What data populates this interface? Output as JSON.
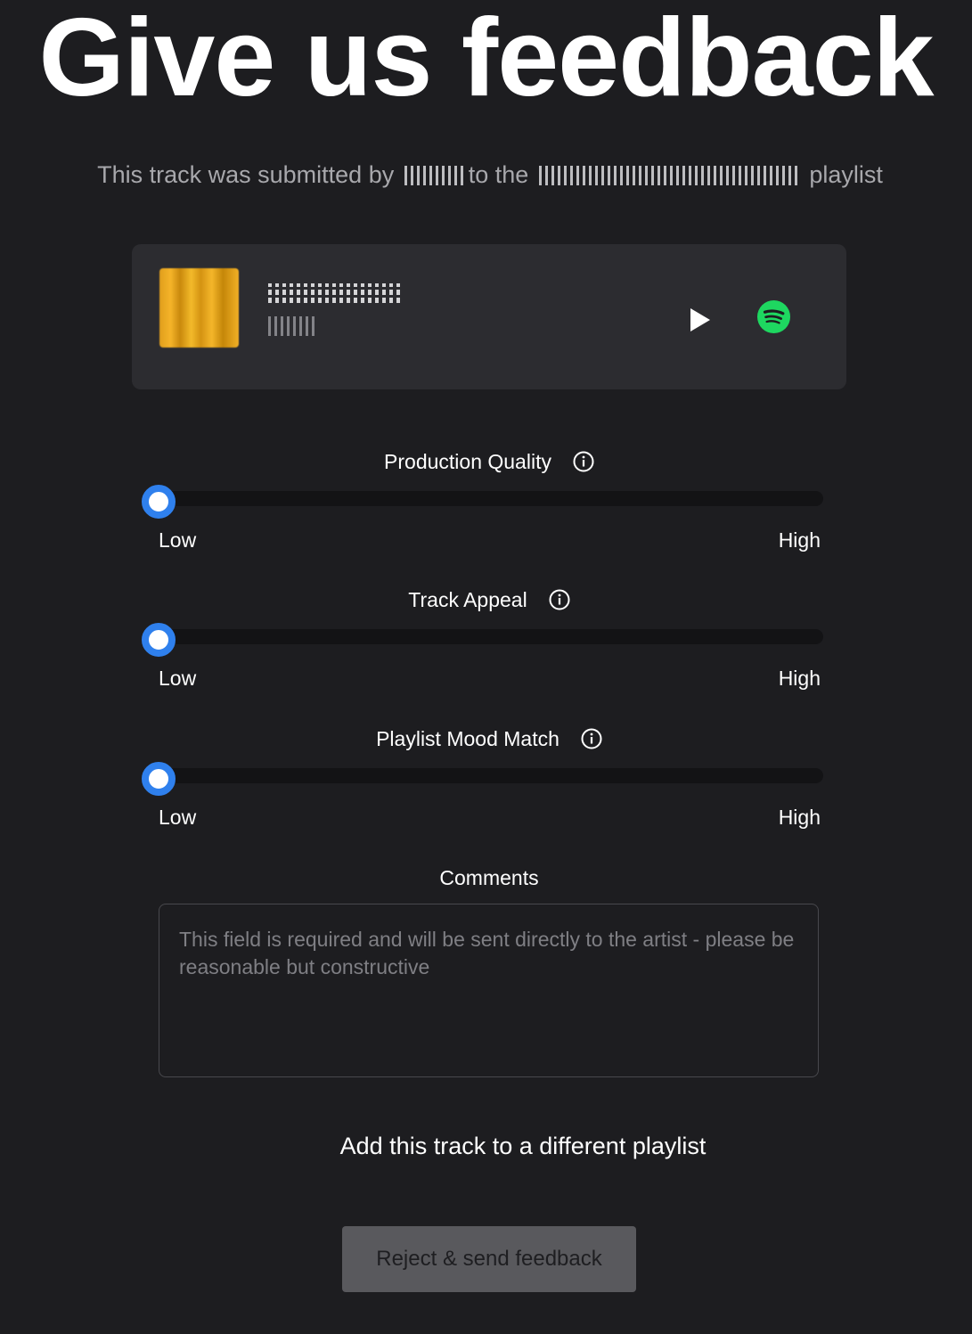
{
  "page": {
    "title": "Give us feedback",
    "subtitle": {
      "prefix": "This track was submitted by",
      "middle": "to the",
      "suffix": "playlist",
      "redacted_user": "",
      "redacted_playlist": ""
    }
  },
  "track_card": {
    "track_name": "",
    "artist_name": "",
    "play_icon": "play-icon",
    "spotify_icon": "spotify-icon",
    "spotify_color": "#1ed760"
  },
  "sliders": [
    {
      "label": "Production Quality",
      "low_label": "Low",
      "high_label": "High",
      "value": 0
    },
    {
      "label": "Track Appeal",
      "low_label": "Low",
      "high_label": "High",
      "value": 0
    },
    {
      "label": "Playlist Mood Match",
      "low_label": "Low",
      "high_label": "High",
      "value": 0
    }
  ],
  "comments": {
    "label": "Comments",
    "placeholder": "This field is required and will be sent directly to the artist - please be reasonable but constructive",
    "value": ""
  },
  "add_to_playlist_label": "Add this track to a different playlist",
  "reject_button_label": "Reject & send feedback",
  "colors": {
    "background": "#1d1d20",
    "card": "#2c2c30",
    "slider_thumb_border": "#2f80ed",
    "button_bg": "#59595d"
  }
}
